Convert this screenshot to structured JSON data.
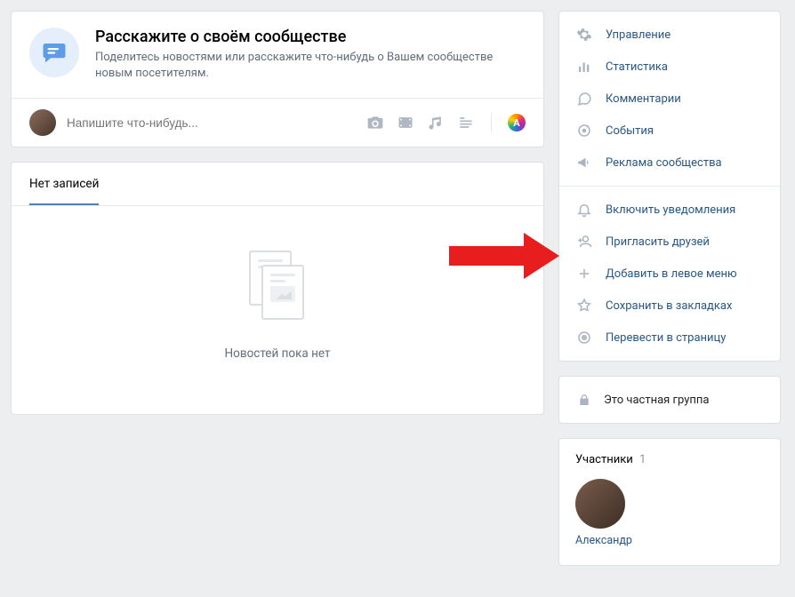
{
  "intro": {
    "title": "Расскажите о своём сообществе",
    "subtitle": "Поделитесь новостями или расскажите что-нибудь о Вашем сообществе новым посетителям."
  },
  "compose": {
    "placeholder": "Напишите что-нибудь..."
  },
  "tabs": {
    "none": "Нет записей"
  },
  "empty": {
    "text": "Новостей пока нет"
  },
  "sidebar": {
    "items": [
      {
        "label": "Управление",
        "icon": "gear-icon"
      },
      {
        "label": "Статистика",
        "icon": "stats-icon"
      },
      {
        "label": "Комментарии",
        "icon": "comment-icon"
      },
      {
        "label": "События",
        "icon": "events-icon"
      },
      {
        "label": "Реклама сообщества",
        "icon": "megaphone-icon"
      }
    ],
    "actions": [
      {
        "label": "Включить уведомления",
        "icon": "bell-icon"
      },
      {
        "label": "Пригласить друзей",
        "icon": "add-user-icon"
      },
      {
        "label": "Добавить в левое меню",
        "icon": "plus-icon"
      },
      {
        "label": "Сохранить в закладках",
        "icon": "star-icon"
      },
      {
        "label": "Перевести в страницу",
        "icon": "convert-icon"
      }
    ]
  },
  "private": {
    "text": "Это частная группа"
  },
  "members": {
    "title": "Участники",
    "count": "1",
    "list": [
      {
        "name": "Александр"
      }
    ]
  }
}
